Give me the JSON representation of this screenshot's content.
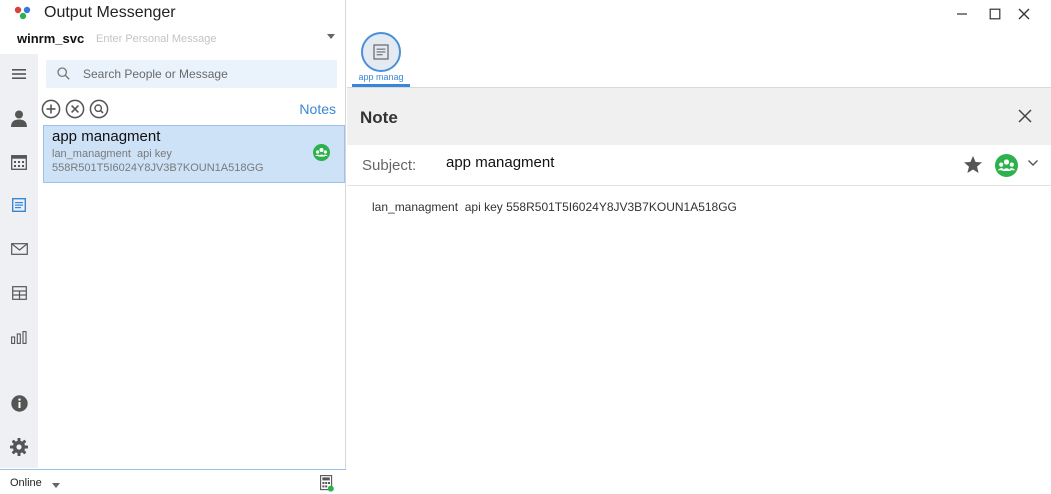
{
  "app": {
    "title": "Output Messenger"
  },
  "user": {
    "name": "winrm_svc",
    "personal_message_placeholder": "Enter Personal Message"
  },
  "search": {
    "placeholder": "Search People or Message"
  },
  "notes_panel": {
    "heading": "Notes",
    "tools": [
      "add-icon",
      "close-circle-icon",
      "search-circle-icon"
    ],
    "items": [
      {
        "title": "app managment",
        "preview_line1": "lan_managment  api key",
        "preview_line2": "558R501T5I6024Y8JV3B7KOUN1A518GG",
        "shared_icon": "group-share-icon"
      }
    ]
  },
  "rail": {
    "items": [
      "menu-icon",
      "user-icon",
      "calendar-icon",
      "notes-icon",
      "mail-icon",
      "table-icon",
      "chart-icon",
      "info-icon",
      "settings-icon"
    ],
    "active": "notes-icon"
  },
  "status": {
    "label": "Online"
  },
  "tabs": [
    {
      "label": "app manag",
      "icon": "note-icon"
    }
  ],
  "note": {
    "header": "Note",
    "subject_label": "Subject:",
    "subject": "app managment",
    "body": "lan_managment  api key 558R501T5I6024Y8JV3B7KOUN1A518GG"
  },
  "colors": {
    "accent": "#3a86d6",
    "share_green": "#2bb24c",
    "selected_bg": "#cde1f7",
    "rail_bg": "#eef0f3"
  }
}
